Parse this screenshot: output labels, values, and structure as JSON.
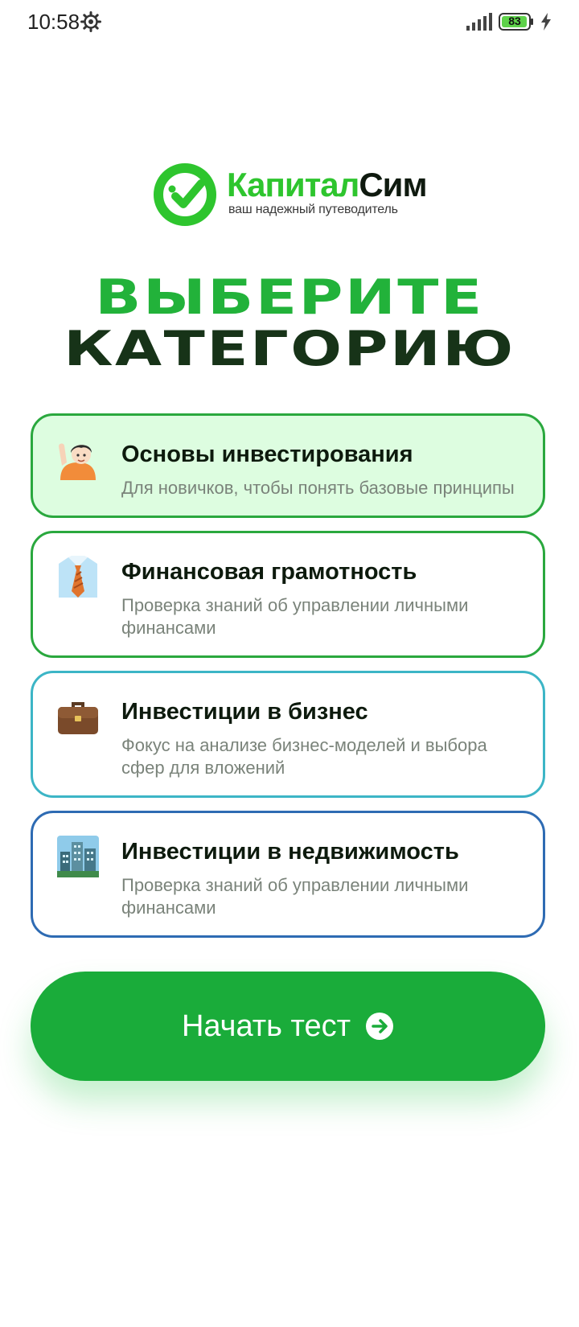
{
  "status_bar": {
    "time": "10:58",
    "battery": "83"
  },
  "logo": {
    "name_part1": "Капитал",
    "name_part2": "Сим",
    "tagline": "ваш надежный путеводитель"
  },
  "title": {
    "line1": "ВЫБЕРИТЕ",
    "line2": "КАТЕГОРИЮ"
  },
  "categories": [
    {
      "icon": "person-raising-hand-icon",
      "title": "Основы инвестирования",
      "description": "Для новичков, чтобы понять базовые принципы",
      "selected": true
    },
    {
      "icon": "shirt-and-tie-icon",
      "title": "Финансовая грамотность",
      "description": "Проверка знаний об управлении личными финансами",
      "selected": false
    },
    {
      "icon": "briefcase-icon",
      "title": "Инвестиции в бизнес",
      "description": "Фокус на анализе бизнес-моделей и выбора сфер для вложений",
      "selected": false
    },
    {
      "icon": "cityscape-icon",
      "title": "Инвестиции в недвижимость",
      "description": "Проверка знаний об управлении личными финансами",
      "selected": false
    }
  ],
  "start_button": {
    "label": "Начать тест",
    "icon": "arrow-right-circle-icon"
  },
  "colors": {
    "accent": "#1aac3a",
    "selected_bg": "#ddfde0",
    "teal_border": "#3cb5c6",
    "blue_border": "#2e6bb3",
    "title_green": "#22b23a",
    "title_dark": "#173318"
  }
}
